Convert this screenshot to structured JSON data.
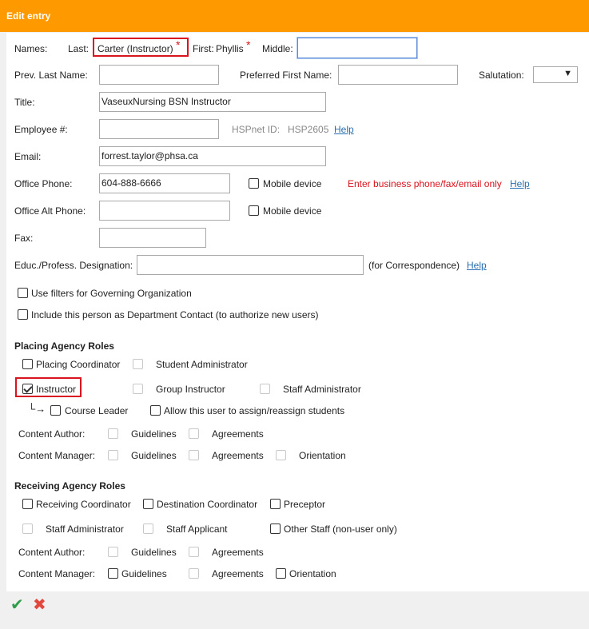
{
  "header": {
    "title": "Edit entry"
  },
  "names": {
    "label": "Names:",
    "last_label": "Last:",
    "last_value": "Carter (Instructor)",
    "first_label": "First:",
    "first_value": "Phyllis",
    "middle_label": "Middle:",
    "required_mark": "*"
  },
  "prev_last": {
    "label": "Prev. Last Name:"
  },
  "preferred_first": {
    "label": "Preferred First Name:"
  },
  "salutation": {
    "label": "Salutation:",
    "arrow": "▼"
  },
  "title_field": {
    "label": "Title:",
    "value": "VaseuxNursing BSN Instructor"
  },
  "employee": {
    "label": "Employee #:",
    "hspnet_label": "HSPnet ID:",
    "hspnet_value": "HSP2605",
    "help": "Help"
  },
  "email": {
    "label": "Email:",
    "value": "forrest.taylor@phsa.ca"
  },
  "office_phone": {
    "label": "Office Phone:",
    "value": "604-888-6666",
    "mobile_label": "Mobile device",
    "notice": "Enter business phone/fax/email only",
    "help": "Help"
  },
  "office_alt_phone": {
    "label": "Office Alt Phone:",
    "mobile_label": "Mobile device"
  },
  "fax": {
    "label": "Fax:"
  },
  "designation": {
    "label": "Educ./Profess. Designation:",
    "note": "(for Correspondence)",
    "help": "Help"
  },
  "options": {
    "governing_filters": "Use filters for Governing Organization",
    "department_contact": "Include this person as Department Contact (to authorize new users)"
  },
  "placing": {
    "title": "Placing Agency Roles",
    "placing_coordinator": "Placing Coordinator",
    "student_administrator": "Student Administrator",
    "instructor": "Instructor",
    "group_instructor": "Group Instructor",
    "staff_administrator": "Staff Administrator",
    "sub_arrow": "└→",
    "course_leader": "Course Leader",
    "allow_assign": "Allow this user to assign/reassign students",
    "content_author": "Content Author:",
    "content_manager": "Content Manager:",
    "guidelines": "Guidelines",
    "agreements": "Agreements",
    "orientation": "Orientation"
  },
  "receiving": {
    "title": "Receiving Agency Roles",
    "receiving_coordinator": "Receiving Coordinator",
    "destination_coordinator": "Destination Coordinator",
    "preceptor": "Preceptor",
    "staff_administrator": "Staff Administrator",
    "staff_applicant": "Staff Applicant",
    "other_staff": "Other Staff (non-user only)",
    "content_author": "Content Author:",
    "content_manager": "Content Manager:",
    "guidelines": "Guidelines",
    "agreements": "Agreements",
    "orientation": "Orientation"
  },
  "footer": {
    "save_glyph": "✔",
    "cancel_glyph": "✖"
  },
  "colors": {
    "header": "#ff9900",
    "highlight": "#d9141f",
    "link": "#2a6fb0",
    "save": "#2e9e48",
    "cancel": "#e2483d"
  }
}
